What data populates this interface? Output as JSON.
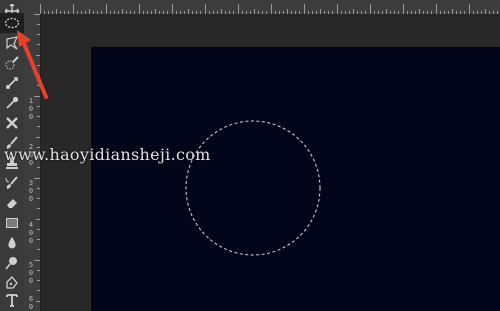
{
  "toolbar": {
    "tools": [
      {
        "name": "move-icon"
      },
      {
        "name": "elliptical-marquee-icon",
        "active": true
      },
      {
        "name": "lasso-icon"
      },
      {
        "name": "quick-selection-icon"
      },
      {
        "name": "crop-icon"
      },
      {
        "name": "eyedropper-icon"
      },
      {
        "name": "spot-healing-icon"
      },
      {
        "name": "brush-icon"
      },
      {
        "name": "clone-stamp-icon"
      },
      {
        "name": "history-brush-icon"
      },
      {
        "name": "eraser-icon"
      },
      {
        "name": "gradient-icon"
      },
      {
        "name": "blur-icon"
      },
      {
        "name": "dodge-icon"
      },
      {
        "name": "pen-icon"
      },
      {
        "name": "type-icon"
      }
    ]
  },
  "ruler_left": {
    "labels": [
      "1",
      "0",
      "0",
      "2",
      "0",
      "0",
      "3",
      "0",
      "0",
      "4",
      "0",
      "0",
      "5",
      "0",
      "0",
      "6",
      "0",
      "0"
    ]
  },
  "canvas": {
    "background": "#03061a",
    "selection": "elliptical"
  },
  "watermark": {
    "text": "www.haoyidiansheji.com"
  },
  "annotation": {
    "arrow_color": "#e8402a"
  }
}
